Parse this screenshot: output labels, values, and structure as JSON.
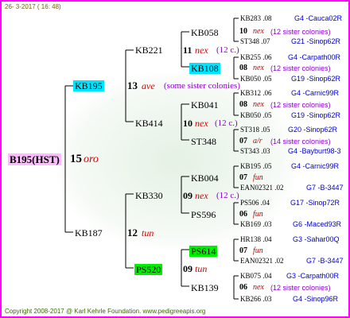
{
  "date": "26- 3-2017 ( 16: 48)",
  "footer": "Copyright 2008-2017 @ Karl Kehrle Foundation.   www.pedigreeapis.org",
  "colors": {
    "frame": "#ff00ff",
    "cyan": "#00e5ff",
    "pink": "#ffbbff",
    "green": "#00ee00",
    "trait": "#cc0000",
    "link": "#0000cc",
    "sister": "#8a00cc"
  },
  "root": {
    "label": "B195(HST)",
    "num": "15",
    "trait": "oro"
  },
  "gen1": [
    {
      "code": "KB195",
      "num": "13",
      "trait": "ave",
      "note": "(some sister colonies)"
    },
    {
      "code": "KB187",
      "num": "12",
      "trait": "tun"
    }
  ],
  "gen2": [
    {
      "code": "KB221",
      "num": "11",
      "trait": "nex",
      "note": "(12 c.)"
    },
    {
      "code": "KB414",
      "num": "10",
      "trait": "nex",
      "note": "(12 c.)"
    },
    {
      "code": "KB330",
      "num": "09",
      "trait": "nex",
      "note": "(12 c.)"
    },
    {
      "code": "PS520",
      "num": "09",
      "trait": "tun"
    }
  ],
  "gen3": [
    {
      "code": "KB058",
      "num": "10",
      "trait": "nex",
      "note": "(12 sister colonies)"
    },
    {
      "code": "KB108",
      "num": "08",
      "trait": "nex",
      "note": "(12 sister colonies)"
    },
    {
      "code": "KB041",
      "num": "08",
      "trait": "nex",
      "note": "(12 sister colonies)"
    },
    {
      "code": "ST348",
      "num": "07",
      "trait": "a/r",
      "note": "(14 sister colonies)"
    },
    {
      "code": "KB004",
      "num": "07",
      "trait": "fun",
      "note": ""
    },
    {
      "code": "PS596",
      "num": "06",
      "trait": "fun",
      "note": ""
    },
    {
      "code": "PS614",
      "num": "07",
      "trait": "fun",
      "note": ""
    },
    {
      "code": "KB139",
      "num": "06",
      "trait": "nex",
      "note": "(12 sister colonies)"
    }
  ],
  "gen4": [
    {
      "sire": "KB283 .08",
      "sire_ped": "G4 -Cauca02R",
      "dam": "ST348 .07",
      "dam_ped": "G21 -Sinop62R"
    },
    {
      "sire": "KB255 .06",
      "sire_ped": "G4 -Carpath00R",
      "dam": "KB050 .05",
      "dam_ped": "G19 -Sinop62R"
    },
    {
      "sire": "KB312 .06",
      "sire_ped": "G4 -Carnic99R",
      "dam": "KB050 .05",
      "dam_ped": "G19 -Sinop62R"
    },
    {
      "sire": "ST318 .05",
      "sire_ped": "G20 -Sinop62R",
      "dam": "ST343 .03",
      "dam_ped": "G4 -Bayburt98-3"
    },
    {
      "sire": "KB195 .05",
      "sire_ped": "G4 -Carnic99R",
      "dam": "EAN02321 .02",
      "dam_ped": "G7 -B-3447"
    },
    {
      "sire": "PS506 .04",
      "sire_ped": "G17 -Sinop72R",
      "dam": "KB169 .03",
      "dam_ped": "G6 -Maced93R"
    },
    {
      "sire": "HR138 .04",
      "sire_ped": "G3 -Sahar00Q",
      "dam": "EAN02321 .02",
      "dam_ped": "G7 -B-3447"
    },
    {
      "sire": "KB075 .04",
      "sire_ped": "G3 -Carpath00R",
      "dam": "KB266 .03",
      "dam_ped": "G4 -Sinop96R"
    }
  ]
}
